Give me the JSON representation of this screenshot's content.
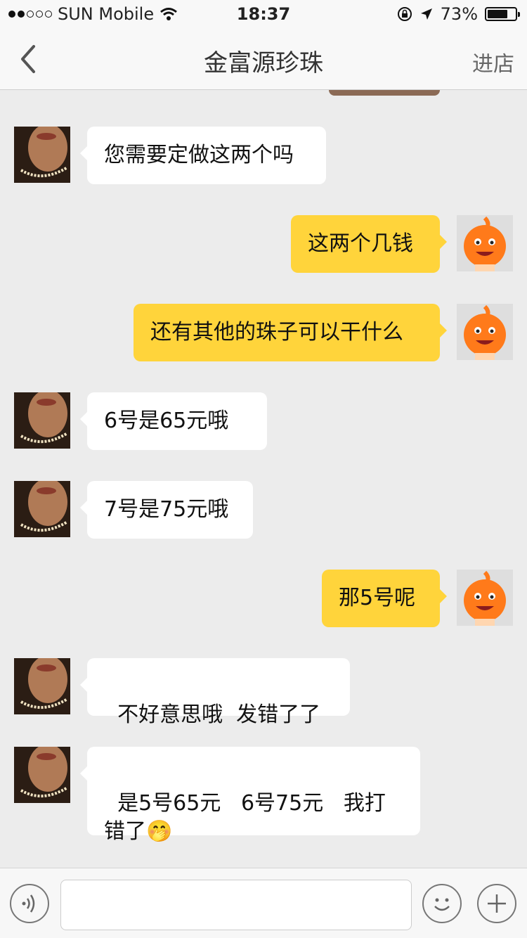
{
  "status_bar": {
    "carrier": "SUN Mobile",
    "time": "18:37",
    "battery": "73%",
    "battery_level": 0.73,
    "signal_bars_filled": 2
  },
  "nav": {
    "back_icon": "chevron-left-icon",
    "title": "金富源珍珠",
    "right_label": "进店"
  },
  "messages": [
    {
      "side": "in",
      "text": "您需要定做这两个吗"
    },
    {
      "side": "out",
      "text": "这两个几钱"
    },
    {
      "side": "out",
      "text": "还有其他的珠子可以干什么"
    },
    {
      "side": "in",
      "text": "6号是65元哦"
    },
    {
      "side": "in",
      "text": "7号是75元哦"
    },
    {
      "side": "out",
      "text": "那5号呢"
    },
    {
      "side": "in",
      "text": "不好意思哦  发错了了"
    },
    {
      "side": "in",
      "text": "是5号65元   6号75元   我打错了🤭"
    }
  ],
  "input_bar": {
    "voice_icon": "voice-icon",
    "emoji_icon": "smiley-icon",
    "plus_icon": "plus-icon",
    "input_value": ""
  },
  "colors": {
    "incoming_bubble": "#ffffff",
    "outgoing_bubble": "#ffd43b",
    "background": "#ececec"
  }
}
